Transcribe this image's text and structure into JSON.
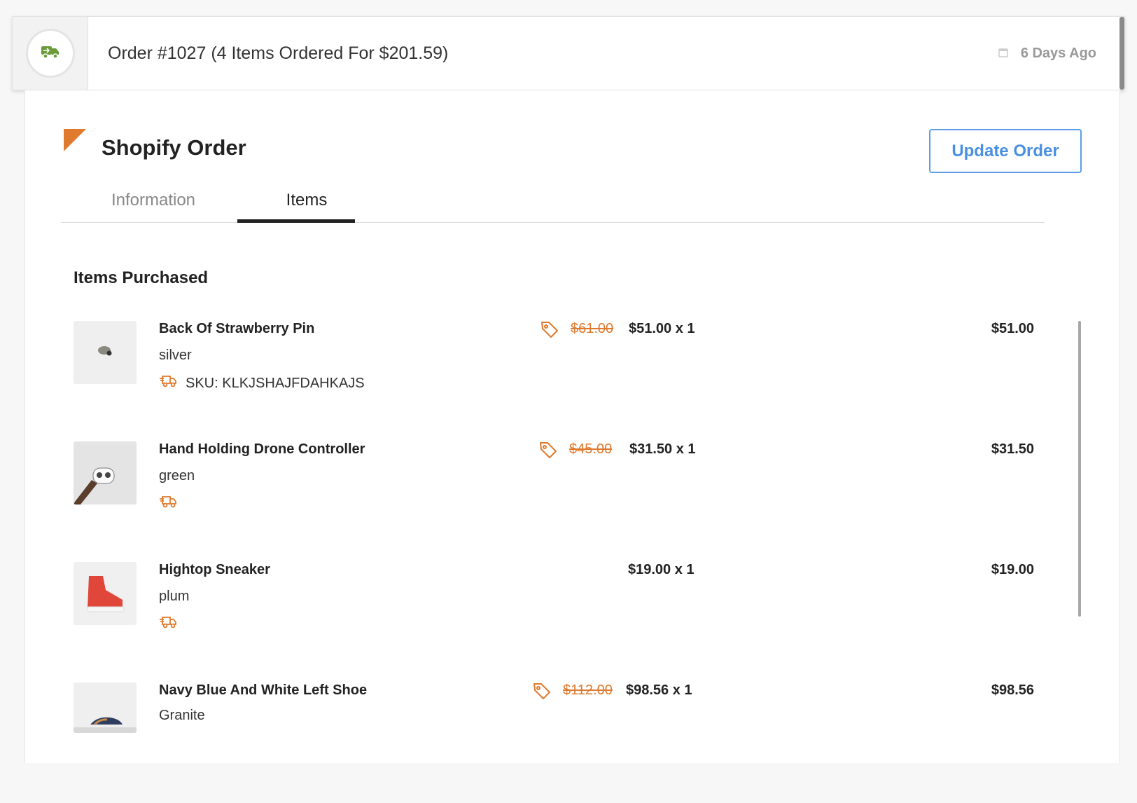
{
  "header": {
    "title": "Order #1027 (4 Items Ordered For $201.59)",
    "date": "6 Days Ago",
    "status_icon": "delivery-truck-icon",
    "date_icon": "calendar-icon"
  },
  "card": {
    "title": "Shopify Order",
    "update_button": "Update Order"
  },
  "tabs": [
    {
      "label": "Information",
      "active": false
    },
    {
      "label": "Items",
      "active": true
    }
  ],
  "section": {
    "title": "Items Purchased"
  },
  "items": [
    {
      "name": "Back Of Strawberry Pin",
      "variant": "silver",
      "sku": "SKU: KLKJSHAJFDAHKAJS",
      "original_price": "$61.00",
      "unit_price": "$51.00 x 1",
      "total": "$51.00"
    },
    {
      "name": "Hand Holding Drone Controller",
      "variant": "green",
      "sku": "",
      "original_price": "$45.00",
      "unit_price": "$31.50 x 1",
      "total": "$31.50"
    },
    {
      "name": "Hightop Sneaker",
      "variant": "plum",
      "sku": "",
      "original_price": "",
      "unit_price": "$19.00 x 1",
      "total": "$19.00"
    },
    {
      "name": "Navy Blue And White Left Shoe",
      "variant": "Granite",
      "sku": "",
      "original_price": "$112.00",
      "unit_price": "$98.56 x 1",
      "total": "$98.56"
    }
  ],
  "colors": {
    "accent": "#e07a2e",
    "button": "#4a90e2",
    "status_green": "#6a9a3a"
  }
}
